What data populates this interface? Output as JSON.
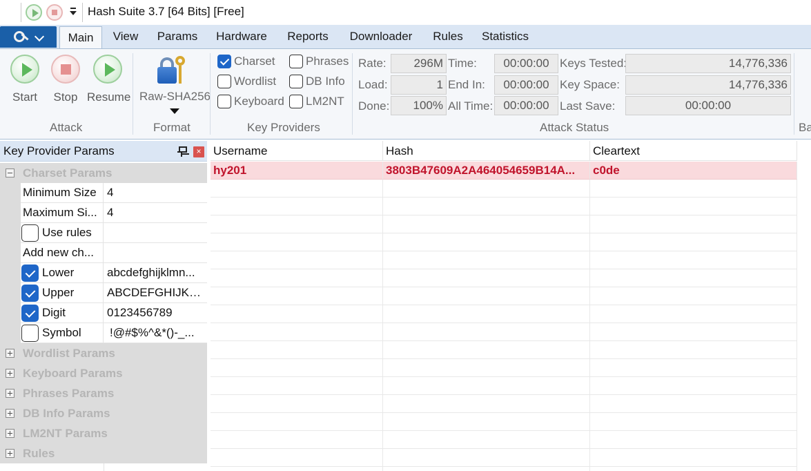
{
  "window": {
    "title": "Hash Suite 3.7 [64 Bits] [Free]"
  },
  "ribbon_tabs": [
    "Main",
    "View",
    "Params",
    "Hardware",
    "Reports",
    "Downloader",
    "Rules",
    "Statistics"
  ],
  "active_tab": "Main",
  "attack": {
    "start_label": "Start",
    "stop_label": "Stop",
    "resume_label": "Resume",
    "group_label": "Attack"
  },
  "format": {
    "value": "Raw-SHA256",
    "group_label": "Format"
  },
  "key_providers": {
    "group_label": "Key Providers",
    "items": [
      {
        "label": "Charset",
        "checked": true
      },
      {
        "label": "Wordlist",
        "checked": false
      },
      {
        "label": "Keyboard",
        "checked": false
      },
      {
        "label": "Phrases",
        "checked": false
      },
      {
        "label": "DB Info",
        "checked": false
      },
      {
        "label": "LM2NT",
        "checked": false
      }
    ]
  },
  "attack_status": {
    "group_label": "Attack Status",
    "rate_label": "Rate:",
    "rate": "296M",
    "load_label": "Load:",
    "load": "1",
    "done_label": "Done:",
    "done": "100%",
    "time_label": "Time:",
    "time": "00:00:00",
    "end_in_label": "End In:",
    "end_in": "00:00:00",
    "all_time_label": "All Time:",
    "all_time": "00:00:00",
    "keys_tested_label": "Keys Tested:",
    "keys_tested": "14,776,336",
    "key_space_label": "Key Space:",
    "key_space": "14,776,336",
    "last_save_label": "Last Save:",
    "last_save": "00:00:00",
    "overflow_label": "Ba"
  },
  "key_provider_params": {
    "title": "Key Provider Params",
    "charset_section": "Charset Params",
    "rows": [
      {
        "name": "Minimum Size",
        "value": "4"
      },
      {
        "name": "Maximum Si...",
        "value": "4"
      },
      {
        "name": "Use rules",
        "value": "",
        "checked": false
      },
      {
        "name": "Add new ch...",
        "value": ""
      },
      {
        "name": "Lower",
        "value": "abcdefghijklmn...",
        "checked": true
      },
      {
        "name": "Upper",
        "value": "ABCDEFGHIJKL...",
        "checked": true
      },
      {
        "name": "Digit",
        "value": "0123456789",
        "checked": true
      },
      {
        "name": "Symbol",
        "value": "!@#$%^&*()-_...",
        "checked": false
      }
    ],
    "collapsed_sections": [
      "Wordlist Params",
      "Keyboard Params",
      "Phrases Params",
      "DB Info Params",
      "LM2NT Params",
      "Rules"
    ]
  },
  "results": {
    "columns": [
      "Username",
      "Hash",
      "Cleartext"
    ],
    "rows": [
      {
        "username": "hy201",
        "hash": "3803B47609A2A464054659B14A...",
        "cleartext": "c0de"
      }
    ]
  },
  "colors": {
    "found_row_bg": "#fadadd",
    "found_row_text": "#c0142c",
    "accent": "#1e66c8"
  }
}
